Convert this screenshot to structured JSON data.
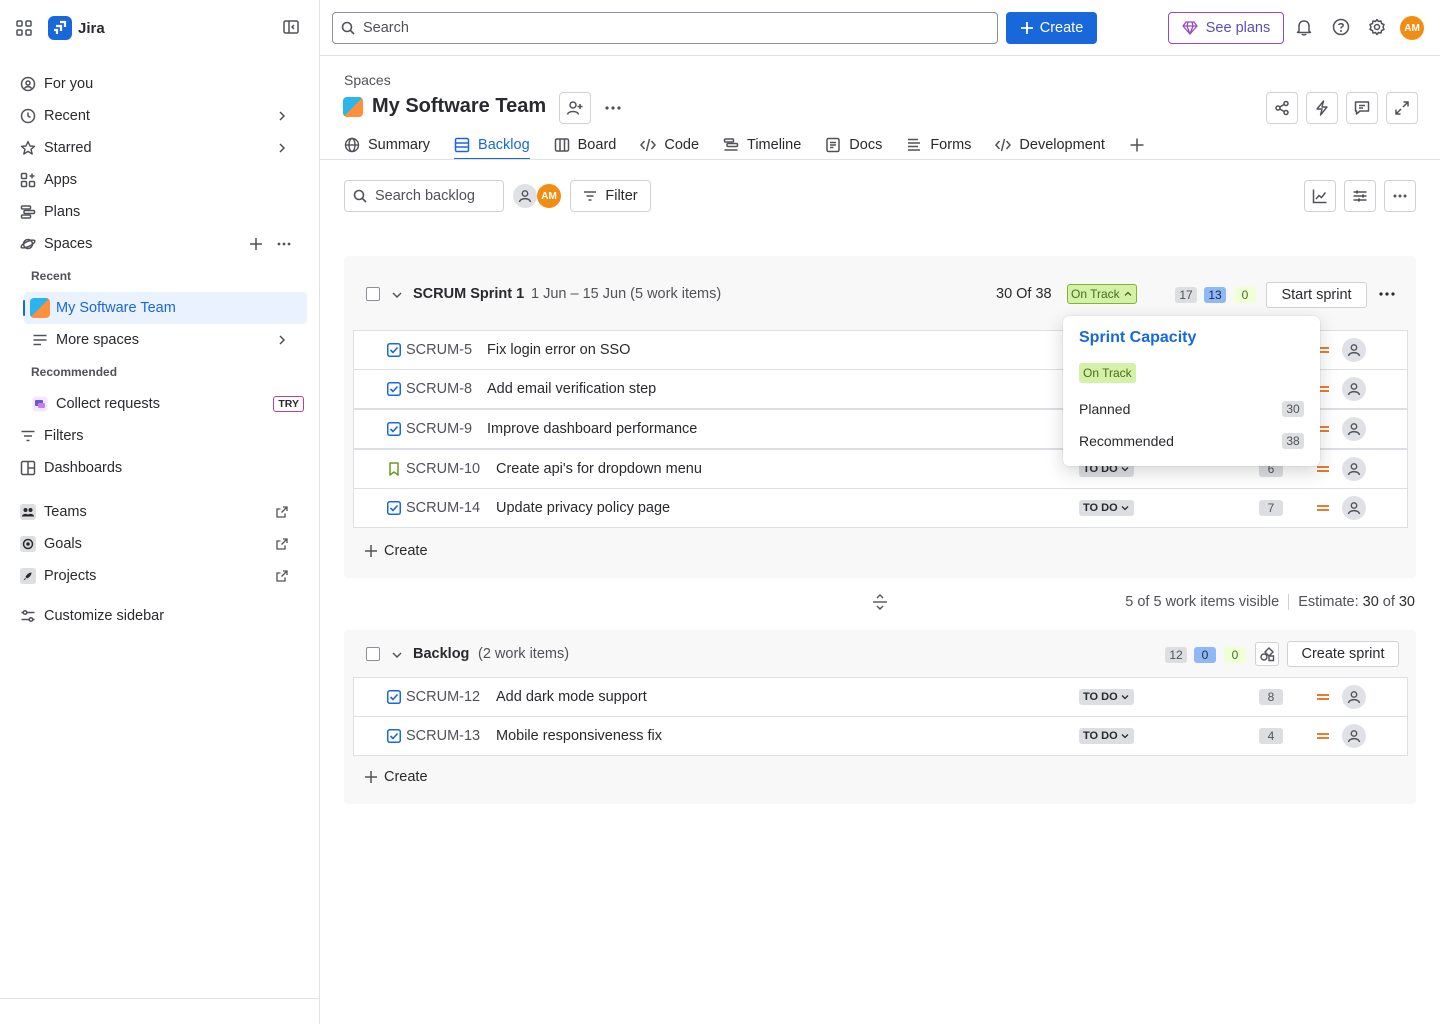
{
  "sidebar": {
    "app_name": "Jira",
    "nav": {
      "for_you": "For you",
      "recent": "Recent",
      "starred": "Starred",
      "apps": "Apps",
      "plans": "Plans",
      "spaces": "Spaces"
    },
    "section_recent": "Recent",
    "my_software_team": "My Software Team",
    "more_spaces": "More spaces",
    "section_recommended": "Recommended",
    "collect_requests": "Collect requests",
    "try_badge": "TRY",
    "filters": "Filters",
    "dashboards": "Dashboards",
    "teams": "Teams",
    "goals": "Goals",
    "projects": "Projects",
    "customize": "Customize sidebar"
  },
  "topbar": {
    "search_placeholder": "Search",
    "create_label": "Create",
    "see_plans_label": "See plans",
    "avatar_initials": "AM"
  },
  "header": {
    "breadcrumb": "Spaces",
    "title": "My Software Team",
    "tabs": [
      "Summary",
      "Backlog",
      "Board",
      "Code",
      "Timeline",
      "Docs",
      "Forms",
      "Development"
    ]
  },
  "toolbar": {
    "search_placeholder": "Search backlog",
    "avatar_initials": "AM",
    "filter_label": "Filter"
  },
  "sprint": {
    "name": "SCRUM Sprint 1",
    "dates": "1 Jun – 15 Jun (5 work items)",
    "capacity": "30 Of 38",
    "status": "On Track",
    "counts": [
      "17",
      "13",
      "0"
    ],
    "start_label": "Start sprint",
    "create_label": "Create",
    "items": [
      {
        "key": "SCRUM-5",
        "summary": "Fix login error on SSO",
        "type": "task"
      },
      {
        "key": "SCRUM-8",
        "summary": "Add email verification step",
        "type": "task"
      },
      {
        "key": "SCRUM-9",
        "summary": "Improve dashboard performance",
        "type": "task"
      },
      {
        "key": "SCRUM-10",
        "summary": "Create api's for dropdown menu",
        "type": "story",
        "status": "TO DO",
        "estimate": "6"
      },
      {
        "key": "SCRUM-14",
        "summary": "Update privacy policy page",
        "type": "task",
        "status": "TO DO",
        "estimate": "7"
      }
    ]
  },
  "capacity_popup": {
    "title": "Sprint Capacity",
    "status": "On Track",
    "planned_label": "Planned",
    "planned_value": "30",
    "recommended_label": "Recommended",
    "recommended_value": "38"
  },
  "summary_bar": {
    "visible": "5 of 5 work items visible",
    "estimate_label": "Estimate:",
    "estimate_value": "30",
    "estimate_of": "of",
    "estimate_total": "30"
  },
  "backlog": {
    "name": "Backlog",
    "count": "(2 work items)",
    "counts": [
      "12",
      "0",
      "0"
    ],
    "create_sprint_label": "Create sprint",
    "create_label": "Create",
    "items": [
      {
        "key": "SCRUM-12",
        "summary": "Add dark mode support",
        "status": "TO DO",
        "estimate": "8"
      },
      {
        "key": "SCRUM-13",
        "summary": "Mobile responsiveness fix",
        "status": "TO DO",
        "estimate": "4"
      }
    ]
  },
  "colors": {
    "accent": "#1868db",
    "on_track_bg": "#d3f1a7",
    "priority_medium": "#e56910"
  }
}
